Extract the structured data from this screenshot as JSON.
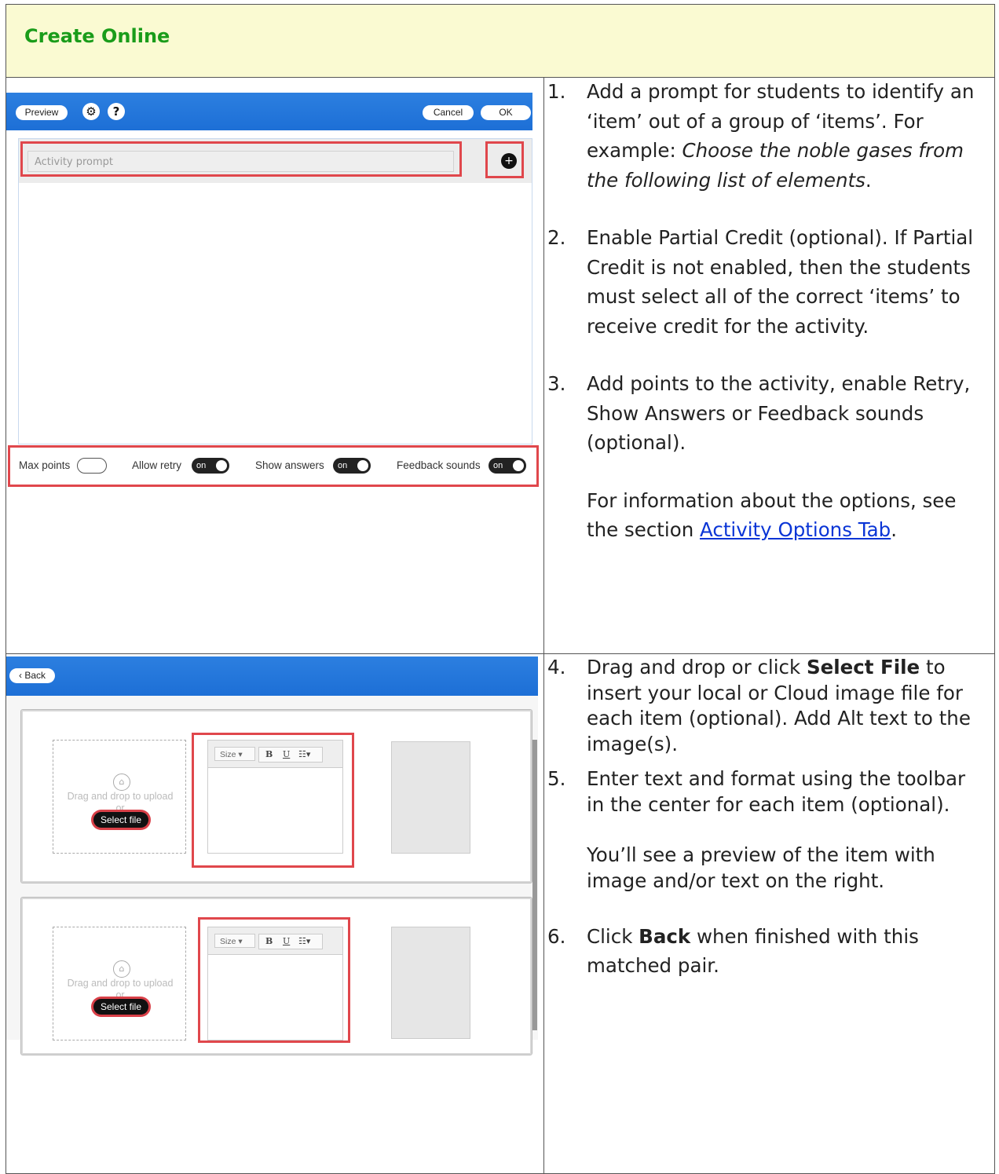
{
  "header": {
    "title": "Create Online"
  },
  "screenshot1": {
    "preview_label": "Preview",
    "gear_glyph": "⚙",
    "help_glyph": "?",
    "cancel_label": "Cancel",
    "ok_label": "OK",
    "prompt_placeholder": "Activity prompt",
    "plus_glyph": "+",
    "options": {
      "max_points": "Max points",
      "allow_retry": "Allow retry",
      "show_answers": "Show answers",
      "feedback_sounds": "Feedback sounds",
      "on_text": "on"
    }
  },
  "screenshot2": {
    "back_label": "‹ Back",
    "drag_text": "Drag and drop to upload",
    "or_text": "or",
    "select_file": "Select file",
    "size_label": "Size",
    "caret": "▾",
    "bold": "B",
    "underline": "U",
    "list": "☷▾"
  },
  "steps": {
    "s1": {
      "num": "1.",
      "text": "Add a prompt for students to identify an ‘item’ out of a group of ‘items’. For example: ",
      "italic": "Choose the noble gases from the following list of elements",
      "end": "."
    },
    "s2": {
      "num": "2.",
      "text": "Enable Partial Credit (optional). If Partial Credit is not enabled, then the students must select all of the correct ‘items’ to receive credit for the activity."
    },
    "s3": {
      "num": "3.",
      "text": "Add points to the activity, enable Retry, Show Answers or Feedback sounds (optional)."
    },
    "note1": {
      "text": "For information about the options, see the section ",
      "link": "Activity Options Tab",
      "end": "."
    },
    "s4": {
      "num": "4.",
      "pre": "Drag and drop or click ",
      "bold": "Select File",
      "post": " to insert your local or Cloud image file for each item (optional). Add Alt text to the image(s)."
    },
    "s5": {
      "num": "5.",
      "text": "Enter text and format using the toolbar in the center for each item (optional)."
    },
    "note2": {
      "text": "You’ll see a preview of the item with image and/or text on the right."
    },
    "s6": {
      "num": "6.",
      "pre": "Click ",
      "bold": "Back",
      "post": " when finished with this matched pair."
    }
  }
}
